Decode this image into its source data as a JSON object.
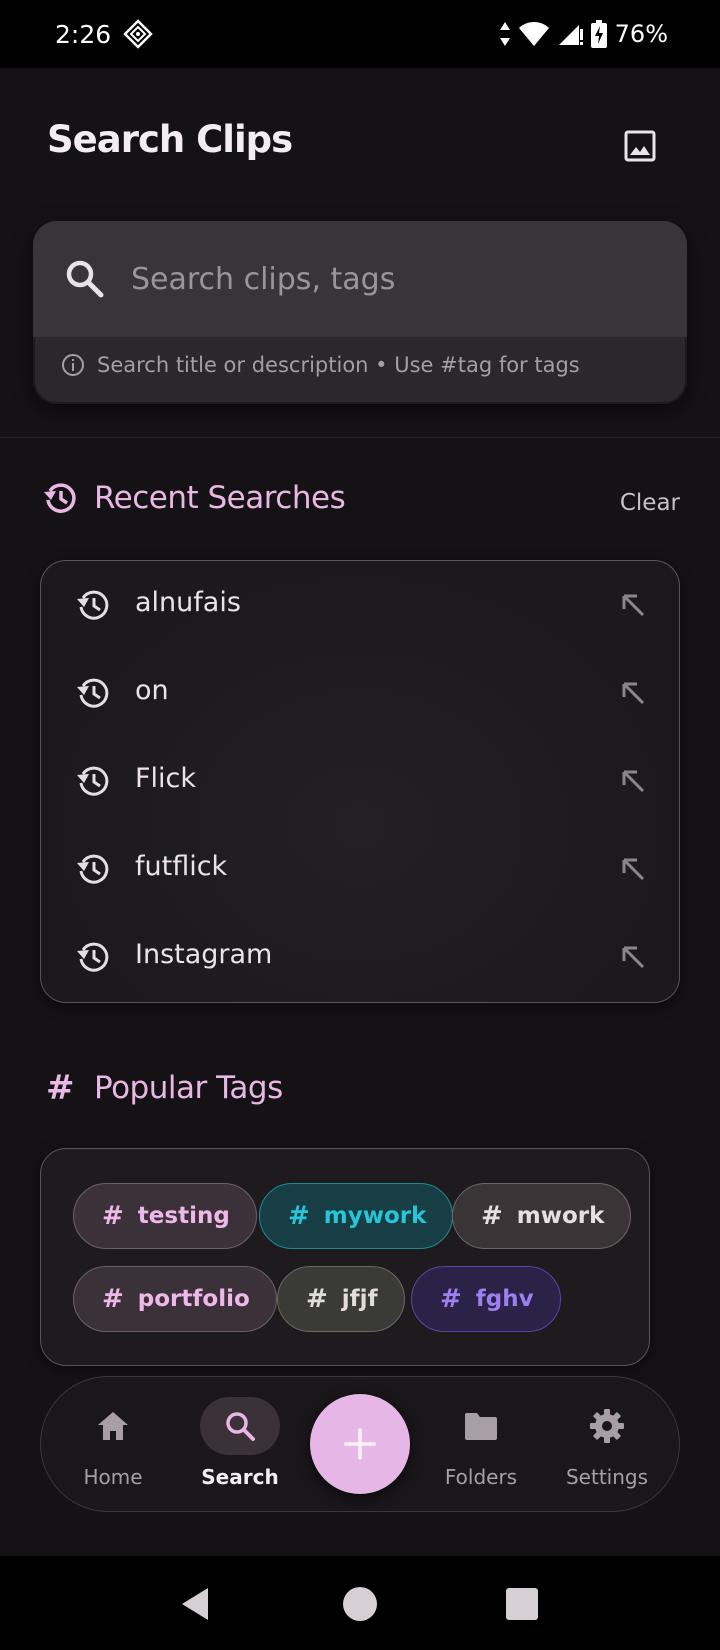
{
  "status_bar": {
    "time": "2:26",
    "battery": "76%"
  },
  "header": {
    "title": "Search Clips",
    "gallery_icon": "image-icon"
  },
  "search": {
    "placeholder": "Search clips, tags",
    "value": "",
    "hint": "Search title or description • Use #tag for tags"
  },
  "recent": {
    "title": "Recent Searches",
    "clear_label": "Clear",
    "items": [
      {
        "label": "alnufais"
      },
      {
        "label": "on"
      },
      {
        "label": "Flick"
      },
      {
        "label": "futflick"
      },
      {
        "label": "Instagram"
      }
    ]
  },
  "tags": {
    "title": "Popular Tags",
    "items": [
      {
        "label": "testing",
        "color": "#efb8ea"
      },
      {
        "label": "mywork",
        "color": "#28c4d7"
      },
      {
        "label": "mwork",
        "color": "#e7dfe4"
      },
      {
        "label": "portfolio",
        "color": "#efb8ea"
      },
      {
        "label": "jfjf",
        "color": "#e2ddd7"
      },
      {
        "label": "fghv",
        "color": "#9d7ff0"
      }
    ]
  },
  "nav": {
    "home": "Home",
    "search": "Search",
    "folders": "Folders",
    "settings": "Settings",
    "active": "search"
  },
  "colors": {
    "accent": "#e8b7e4",
    "fab": "#e6b6e6",
    "background": "#151215"
  }
}
